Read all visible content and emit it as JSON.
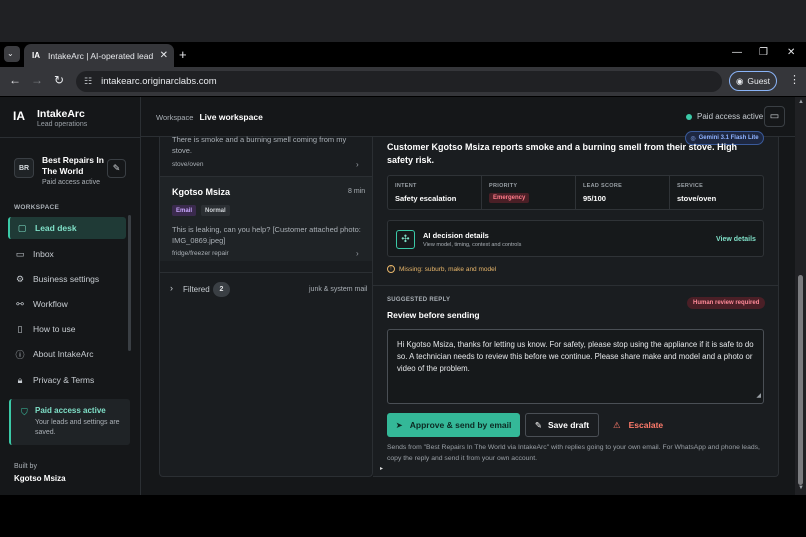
{
  "browser": {
    "tab_title": "IntakeArc | AI-operated lead de",
    "tab_favicon": "IA",
    "url": "intakearc.originarclabs.com",
    "profile_label": "Guest"
  },
  "sidebar": {
    "brand_logo": "IA",
    "brand_name": "IntakeArc",
    "brand_sub": "Lead operations",
    "business_initials": "BR",
    "business_name": "Best Repairs In The World",
    "business_status": "Paid access active",
    "section_label": "WORKSPACE",
    "items": [
      {
        "label": "Lead desk",
        "icon": "chat-icon"
      },
      {
        "label": "Inbox",
        "icon": "inbox-icon"
      },
      {
        "label": "Business settings",
        "icon": "gear-icon"
      },
      {
        "label": "Workflow",
        "icon": "workflow-icon"
      },
      {
        "label": "How to use",
        "icon": "book-icon"
      },
      {
        "label": "About IntakeArc",
        "icon": "info-icon"
      },
      {
        "label": "Privacy & Terms",
        "icon": "lock-icon"
      }
    ],
    "paid_card": {
      "title": "Paid access active",
      "desc": "Your leads and settings are saved."
    },
    "built_by_label": "Built by",
    "built_by_name": "Kgotso Msiza"
  },
  "header": {
    "breadcrumb_label": "Workspace",
    "breadcrumb_current": "Live workspace",
    "access_status": "Paid access active"
  },
  "leads": {
    "first": {
      "text": "There is smoke and a burning smell coming from my stove.",
      "tag": "stove/oven"
    },
    "second": {
      "name": "Kgotso Msiza",
      "time": "8 min",
      "channel": "Email",
      "priority": "Normal",
      "text": "This is leaking, can you help? [Customer attached photo: IMG_0869.jpeg]",
      "tag": "fridge/freezer repair"
    },
    "filtered": {
      "label": "Filtered",
      "count": "2",
      "note": "junk & system mail"
    }
  },
  "detail": {
    "model_badge": "Gemini 3.1 Flash Lite",
    "summary": "Customer Kgotso Msiza reports smoke and a burning smell from their stove. High safety risk.",
    "facts": [
      {
        "key": "INTENT",
        "value": "Safety escalation"
      },
      {
        "key": "PRIORITY",
        "value": "Emergency"
      },
      {
        "key": "LEAD SCORE",
        "value": "95/100"
      },
      {
        "key": "SERVICE",
        "value": "stove/oven"
      }
    ],
    "ai": {
      "title": "AI decision details",
      "desc": "View model, timing, context and controls",
      "link": "View details"
    },
    "missing": "Missing: suburb, make and model",
    "suggested_label": "SUGGESTED REPLY",
    "human_review": "Human review required",
    "review_title": "Review before sending",
    "reply_text": "Hi Kgotso Msiza, thanks for letting us know. For safety, please stop using the appliance if it is safe to do so. A technician needs to review this before we continue. Please share make and model and a photo or video of the problem.",
    "approve_label": "Approve & send by email",
    "draft_label": "Save draft",
    "escalate_label": "Escalate",
    "note": "Sends from \"Best Repairs In The World via IntakeArc\" with replies going to your own email. For WhatsApp and phone leads, copy the reply and send it from your own account."
  },
  "colors": {
    "accent": "#3bc9a7",
    "emergency": "#ff7b8a",
    "background": "#151719"
  }
}
